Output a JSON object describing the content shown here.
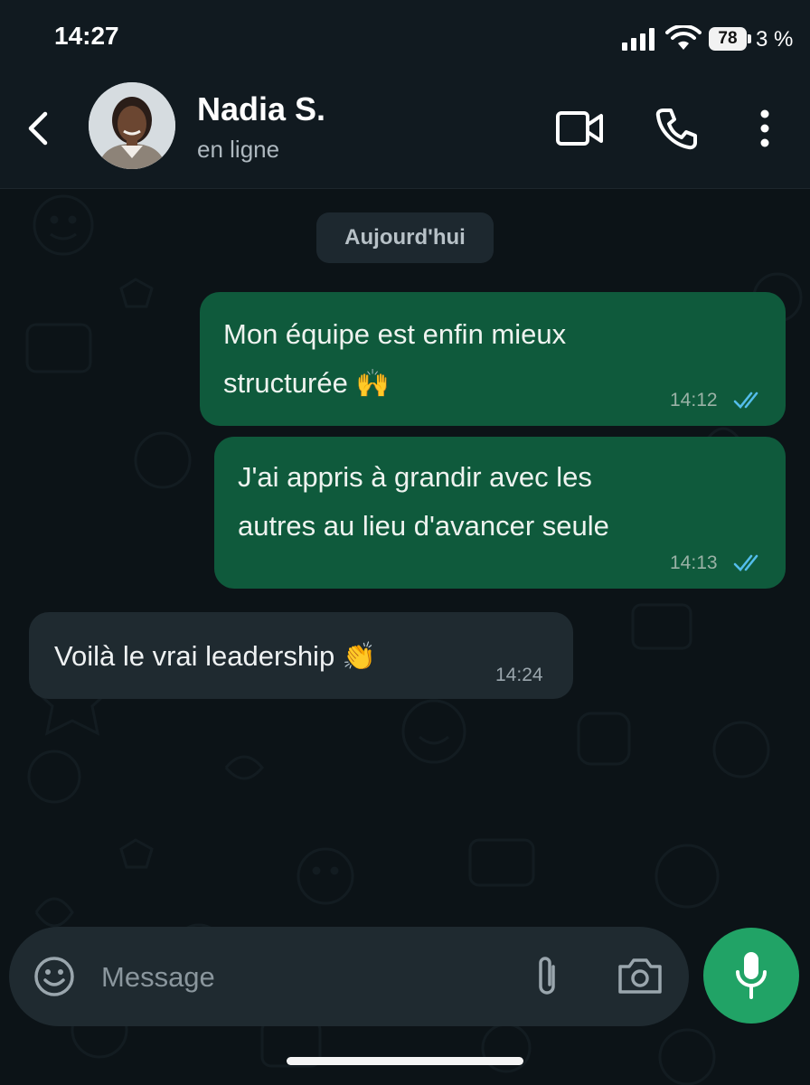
{
  "status_bar": {
    "time": "14:27",
    "battery_level": "78",
    "battery_percent": "3 %"
  },
  "header": {
    "contact_name": "Nadia S.",
    "contact_status": "en ligne"
  },
  "chat": {
    "date_chip": "Aujourd'hui",
    "messages": [
      {
        "direction": "outgoing",
        "lines": [
          "Mon équipe est enfin mieux",
          "structurée"
        ],
        "emoji": "🙌",
        "time": "14:12",
        "status": "read"
      },
      {
        "direction": "outgoing",
        "lines": [
          "J'ai appris à grandir avec les",
          "autres au lieu d'avancer seule"
        ],
        "time": "14:13",
        "status": "read"
      },
      {
        "direction": "incoming",
        "lines": [
          "Voilà le vrai leadership"
        ],
        "emoji": "👏",
        "time": "14:24"
      }
    ]
  },
  "composer": {
    "placeholder": "Message"
  },
  "colors": {
    "outgoing_bubble": "#0f5a3c",
    "incoming_bubble": "#1f2a30",
    "accent": "#21a366",
    "read_ticks": "#53bdeb"
  },
  "icons": [
    "back-arrow-icon",
    "video-call-icon",
    "phone-icon",
    "more-options-icon",
    "emoji-icon",
    "attach-icon",
    "camera-icon",
    "mic-icon",
    "double-check-icon"
  ]
}
